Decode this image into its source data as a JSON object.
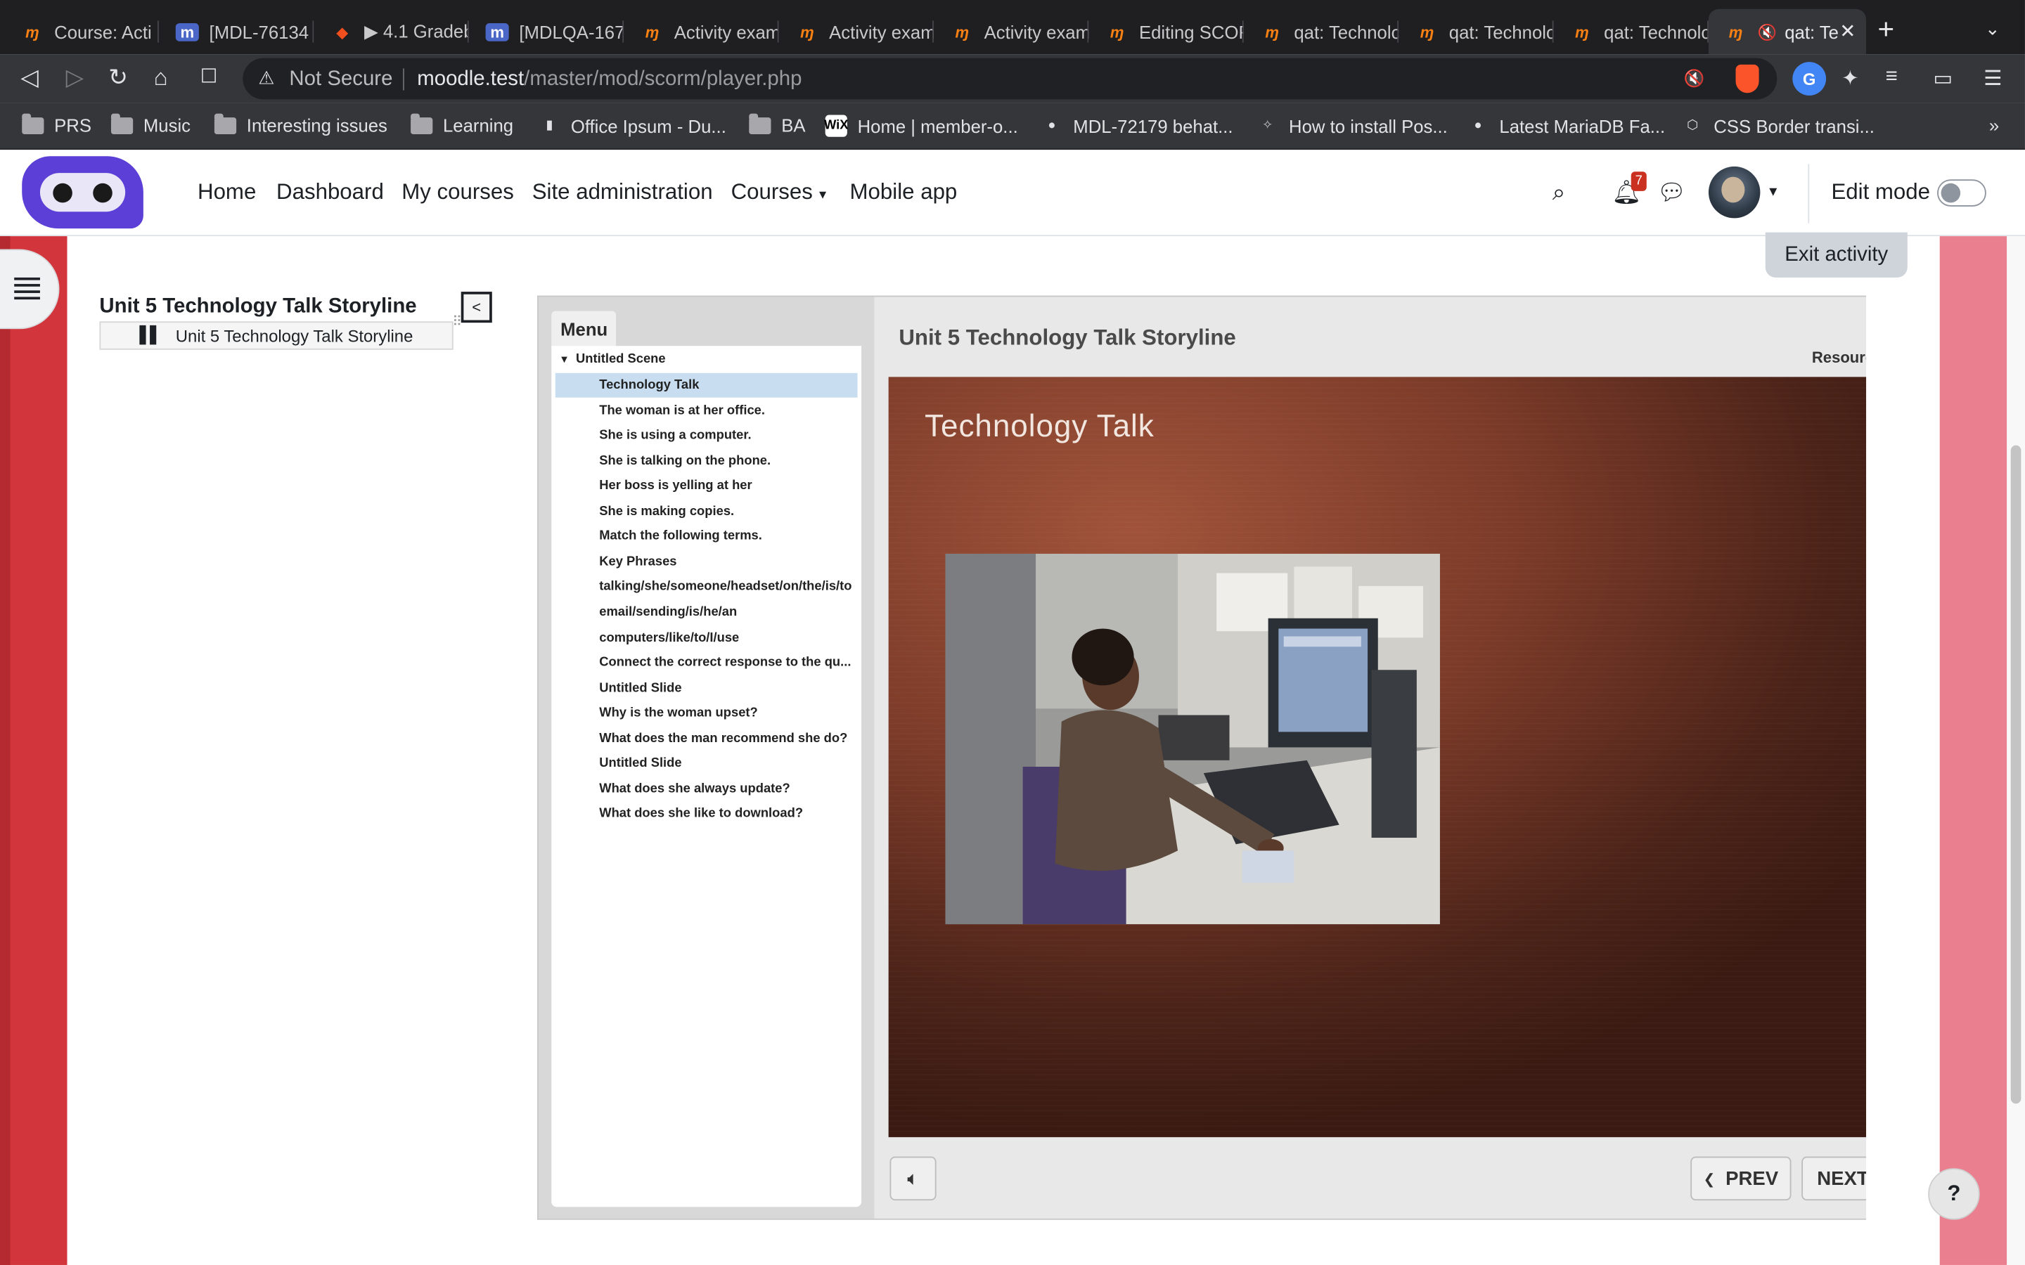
{
  "browser": {
    "tabs": [
      {
        "title": "Course: Acti",
        "icon": "moodle"
      },
      {
        "title": "[MDL-76134",
        "icon": "tracker"
      },
      {
        "title": "▶ 4.1 Gradeb",
        "icon": "figma"
      },
      {
        "title": "[MDLQA-167",
        "icon": "tracker"
      },
      {
        "title": "Activity exam",
        "icon": "moodle"
      },
      {
        "title": "Activity exam",
        "icon": "moodle"
      },
      {
        "title": "Activity exam",
        "icon": "moodle"
      },
      {
        "title": "Editing SCOR",
        "icon": "moodle"
      },
      {
        "title": "qat: Technolo",
        "icon": "moodle"
      },
      {
        "title": "qat: Technolo",
        "icon": "moodle"
      },
      {
        "title": "qat: Technolo",
        "icon": "moodle"
      },
      {
        "title": "qat: Te",
        "icon": "moodle",
        "active": true,
        "muted": true
      }
    ],
    "new_tab": "+",
    "address": {
      "security": "Not Secure",
      "host": "moodle.test",
      "path": "/master/mod/scorm/player.php"
    },
    "bookmarks": [
      {
        "label": "PRS",
        "icon": "folder"
      },
      {
        "label": "Music",
        "icon": "folder"
      },
      {
        "label": "Interesting issues",
        "icon": "folder"
      },
      {
        "label": "Learning",
        "icon": "folder"
      },
      {
        "label": "Office Ipsum - Du...",
        "icon": "office"
      },
      {
        "label": "BA",
        "icon": "folder"
      },
      {
        "label": "Home | member-o...",
        "icon": "wix"
      },
      {
        "label": "MDL-72179 behat...",
        "icon": "github"
      },
      {
        "label": "How to install Pos...",
        "icon": "page"
      },
      {
        "label": "Latest MariaDB Fa...",
        "icon": "github"
      },
      {
        "label": "CSS Border transi...",
        "icon": "codepen"
      }
    ],
    "bookmarks_more": "»"
  },
  "moodle": {
    "nav": [
      "Home",
      "Dashboard",
      "My courses",
      "Site administration",
      "Courses",
      "Mobile app"
    ],
    "notification_count": "7",
    "edit_mode_label": "Edit mode",
    "edit_mode_on": false,
    "exit_activity": "Exit activity"
  },
  "toc": {
    "title": "Unit 5 Technology Talk Storyline",
    "item": "Unit 5 Technology Talk Storyline",
    "collapse": "<"
  },
  "player": {
    "menu_tab": "Menu",
    "scene": "Untitled Scene",
    "slides": [
      "Technology Talk",
      "The woman is at her office.",
      "She is using a computer.",
      "She is talking on the phone.",
      "Her boss is yelling at her",
      "She is making copies.",
      "Match the following terms.",
      "Key Phrases",
      "talking/she/someone/headset/on/the/is/to",
      "email/sending/is/he/an",
      "computers/like/to/I/use",
      "Connect the correct response to the qu...",
      "Untitled Slide",
      "Why is the woman upset?",
      "What does the man recommend she do?",
      "Untitled Slide",
      "What does she always update?",
      "What does she like to download?"
    ],
    "active_slide": 0,
    "title": "Unit 5 Technology Talk Storyline",
    "resources": "Resources",
    "slide_heading": "Technology Talk",
    "prev": "PREV",
    "next": "NEXT"
  },
  "help": "?"
}
